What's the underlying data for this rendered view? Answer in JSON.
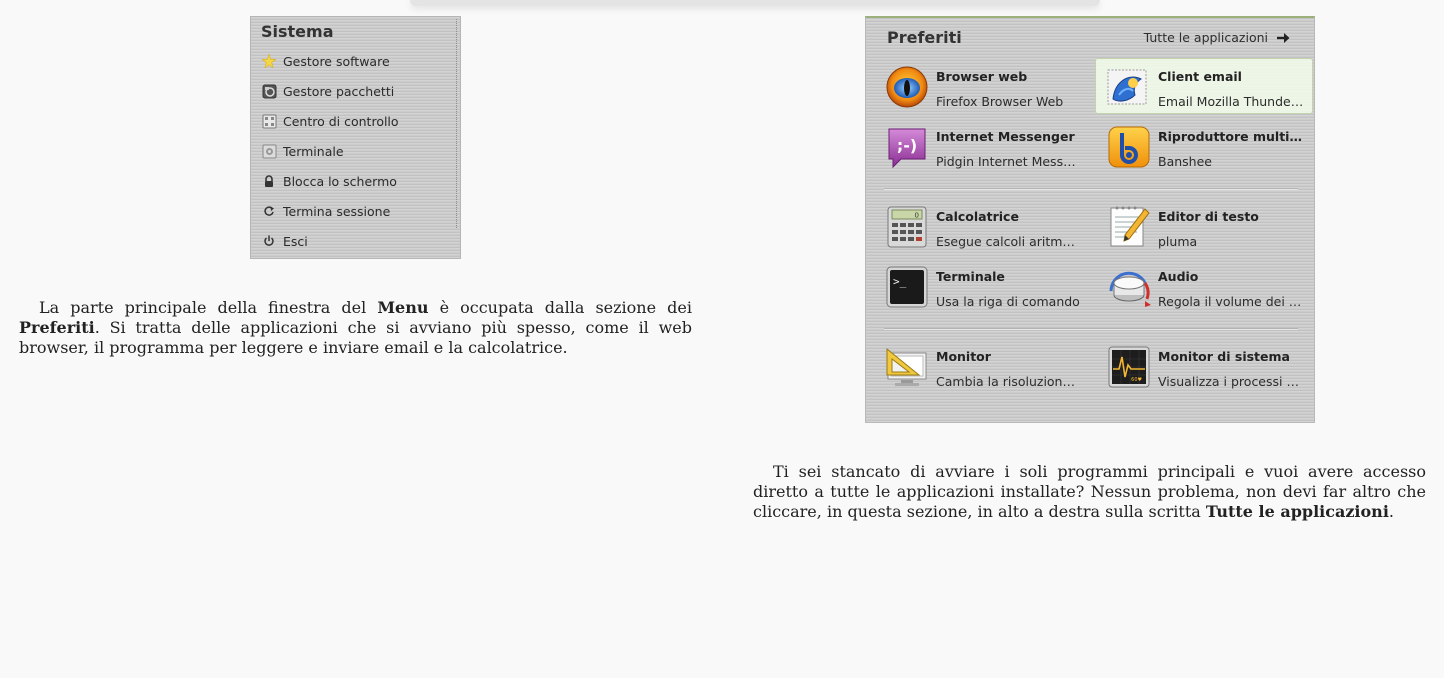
{
  "sistema": {
    "title": "Sistema",
    "items": [
      {
        "label": "Gestore software",
        "icon": "star-icon"
      },
      {
        "label": "Gestore pacchetti",
        "icon": "package-manager-icon"
      },
      {
        "label": "Centro di controllo",
        "icon": "control-center-icon"
      },
      {
        "label": "Terminale",
        "icon": "terminal-small-icon"
      },
      {
        "label": "Blocca lo schermo",
        "icon": "lock-icon"
      },
      {
        "label": "Termina sessione",
        "icon": "logout-icon"
      },
      {
        "label": "Esci",
        "icon": "power-icon"
      }
    ]
  },
  "preferiti": {
    "title": "Preferiti",
    "all_apps_label": "Tutte le applicazioni",
    "apps": [
      {
        "name": "Browser web",
        "desc": "Firefox Browser Web",
        "icon": "firefox-icon"
      },
      {
        "name": "Client email",
        "desc": "Email Mozilla Thunderbird",
        "icon": "thunderbird-icon"
      },
      {
        "name": "Internet Messenger",
        "desc": "Pidgin Internet Messenger",
        "icon": "pidgin-icon"
      },
      {
        "name": "Riproduttore multimediale",
        "desc": "Banshee",
        "icon": "banshee-icon"
      },
      {
        "name": "Calcolatrice",
        "desc": "Esegue calcoli aritmetici",
        "icon": "calculator-icon"
      },
      {
        "name": "Editor di testo",
        "desc": "pluma",
        "icon": "text-editor-icon"
      },
      {
        "name": "Terminale",
        "desc": "Usa la riga di comando",
        "icon": "terminal-icon"
      },
      {
        "name": "Audio",
        "desc": "Regola il volume dei suoni",
        "icon": "audio-knob-icon"
      },
      {
        "name": "Monitor",
        "desc": "Cambia la risoluzione e la posizione dei monitor",
        "icon": "monitor-icon"
      },
      {
        "name": "Monitor di sistema",
        "desc": "Visualizza i processi correnti",
        "icon": "system-monitor-icon"
      }
    ]
  },
  "para1": {
    "t1": "La parte principale della finestra del ",
    "b1": "Menu",
    "t2": " è occupata dalla sezione dei ",
    "b2": "Preferiti",
    "t3": ". Si tratta delle applicazioni che si avviano più spesso, come il web browser, il programma per leggere e inviare email e la calcolatrice."
  },
  "para2": {
    "t1": "Ti sei stancato di avviare i soli programmi principali e vuoi avere accesso diretto a tutte le applicazioni installate? Nessun problema, non devi far altro che cliccare, in questa sezione, in alto a destra sulla scritta ",
    "b1": "Tutte le applicazioni",
    "t2": "."
  }
}
